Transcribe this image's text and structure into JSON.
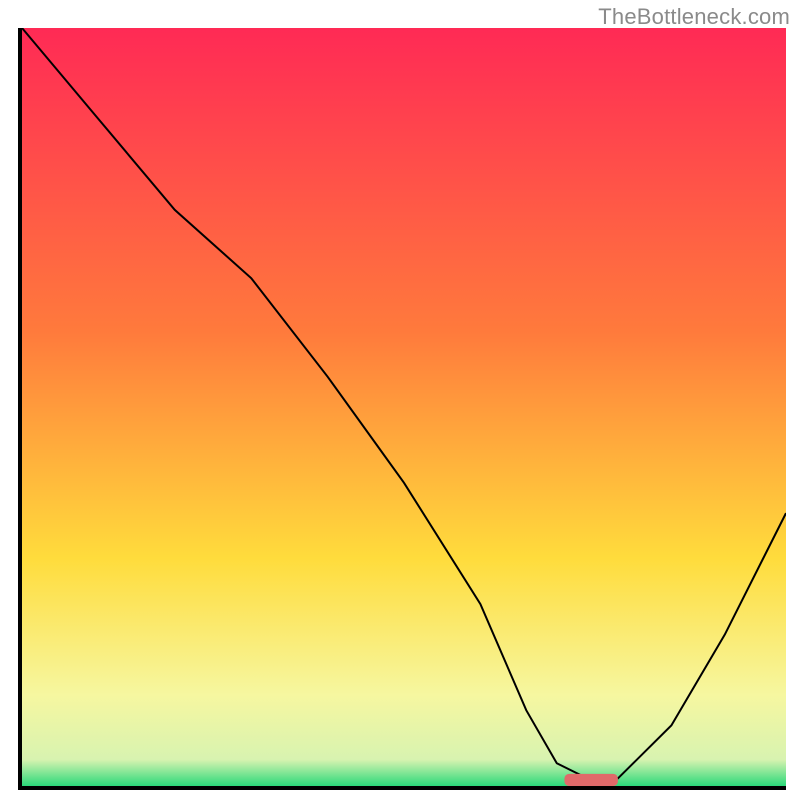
{
  "watermark": "TheBottleneck.com",
  "chart_data": {
    "type": "line",
    "title": "",
    "xlabel": "",
    "ylabel": "",
    "xlim": [
      0,
      100
    ],
    "ylim": [
      0,
      100
    ],
    "grid": false,
    "legend": false,
    "background_gradient": {
      "stops": [
        {
          "offset": 0.0,
          "color": "#ff2a55"
        },
        {
          "offset": 0.4,
          "color": "#ff7a3c"
        },
        {
          "offset": 0.7,
          "color": "#ffdc3c"
        },
        {
          "offset": 0.88,
          "color": "#f6f7a0"
        },
        {
          "offset": 0.965,
          "color": "#d8f3b0"
        },
        {
          "offset": 1.0,
          "color": "#2bd97a"
        }
      ]
    },
    "series": [
      {
        "name": "bottleneck-curve",
        "x": [
          0,
          10,
          20,
          30,
          40,
          50,
          60,
          66,
          70,
          74,
          78,
          85,
          92,
          100
        ],
        "y": [
          100,
          88,
          76,
          67,
          54,
          40,
          24,
          10,
          3,
          1,
          1,
          8,
          20,
          36
        ]
      }
    ],
    "annotations": [
      {
        "name": "optimal-range-marker",
        "type": "segment",
        "x0": 71,
        "x1": 78,
        "y": 0.8,
        "color": "#e06a6a"
      }
    ]
  }
}
